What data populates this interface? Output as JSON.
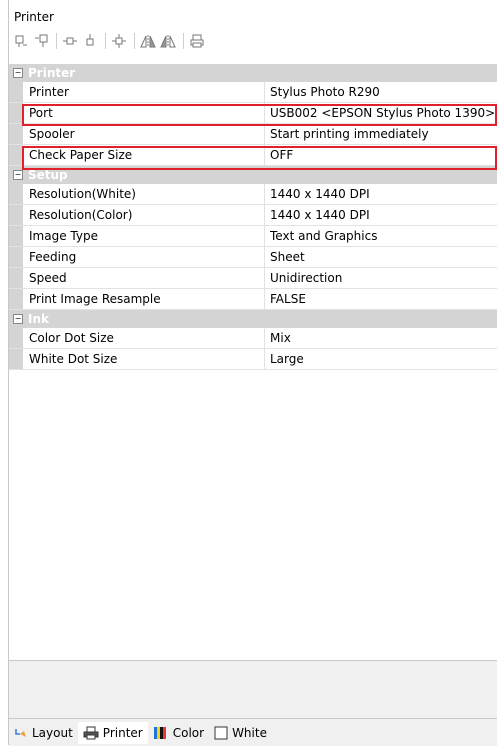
{
  "window": {
    "title": "Printer"
  },
  "toolbar": {
    "icons": [
      "sort-categorized-icon",
      "sort-alphabetical-icon",
      "expand-icon",
      "collapse-icon",
      "properties-icon",
      "mirror-icon",
      "flip-icon",
      "print-icon"
    ]
  },
  "grid": {
    "categories": [
      {
        "name": "Printer",
        "expander": "⊟",
        "rows": [
          {
            "name": "Printer",
            "value": "Stylus Photo R290"
          },
          {
            "name": "Port",
            "value": "USB002  <EPSON Stylus Photo 1390>"
          },
          {
            "name": "Spooler",
            "value": "Start printing immediately"
          },
          {
            "name": "Check Paper Size",
            "value": "OFF"
          }
        ]
      },
      {
        "name": "Setup",
        "expander": "⊟",
        "rows": [
          {
            "name": "Resolution(White)",
            "value": "1440 x 1440 DPI"
          },
          {
            "name": "Resolution(Color)",
            "value": "1440 x 1440 DPI"
          },
          {
            "name": "Image Type",
            "value": "Text and Graphics"
          },
          {
            "name": "Feeding",
            "value": "Sheet"
          },
          {
            "name": "Speed",
            "value": "Unidirection"
          },
          {
            "name": "Print Image Resample",
            "value": "FALSE"
          }
        ]
      },
      {
        "name": "Ink",
        "expander": "⊟",
        "rows": [
          {
            "name": "Color Dot Size",
            "value": "Mix"
          },
          {
            "name": "White Dot Size",
            "value": "Large"
          }
        ]
      }
    ]
  },
  "tabs": [
    {
      "label": "Layout",
      "icon": "layout-icon",
      "active": false
    },
    {
      "label": "Printer",
      "icon": "printer-icon",
      "active": true
    },
    {
      "label": "Color",
      "icon": "color-icon",
      "active": false
    },
    {
      "label": "White",
      "icon": "white-icon",
      "active": false
    }
  ],
  "colors": {
    "highlight": "#e0202a",
    "category_bg": "#d4d4d4",
    "panel_bg": "#f0f0f0"
  }
}
